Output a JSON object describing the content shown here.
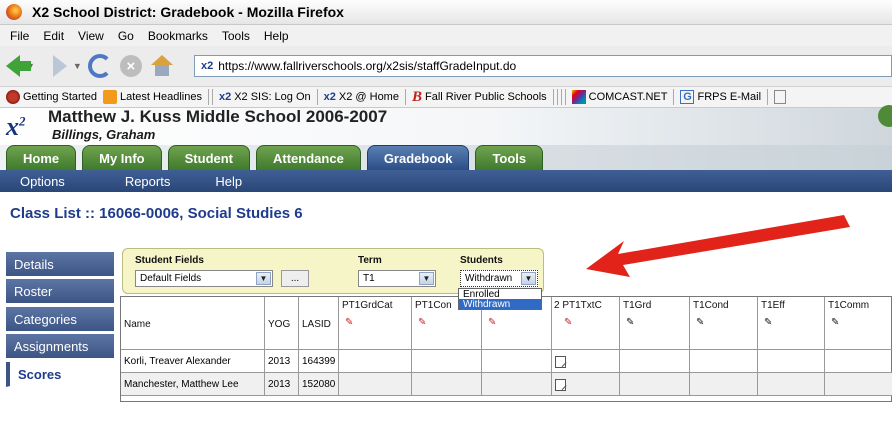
{
  "browser": {
    "title": "X2 School District: Gradebook - Mozilla Firefox",
    "menu": [
      "File",
      "Edit",
      "View",
      "Go",
      "Bookmarks",
      "Tools",
      "Help"
    ],
    "url": "https://www.fallriverschools.org/x2sis/staffGradeInput.do",
    "url_prefix": "x2"
  },
  "bookmarks": [
    "Getting Started",
    "Latest Headlines",
    "X2 SIS: Log On",
    "X2 @ Home",
    "Fall River Public Schools",
    "COMCAST.NET",
    "FRPS E-Mail"
  ],
  "app": {
    "logo": "x",
    "logo_sup": "2",
    "school": "Matthew J. Kuss Middle School 2006-2007",
    "user": "Billings, Graham",
    "tabs": [
      "Home",
      "My Info",
      "Student",
      "Attendance",
      "Gradebook",
      "Tools"
    ],
    "active_tab": "Gradebook",
    "subnav": [
      "Options",
      "Reports",
      "Help"
    ],
    "class_title": "Class List :: 16066-0006, Social Studies 6",
    "side": [
      "Details",
      "Roster",
      "Categories",
      "Assignments",
      "Scores"
    ],
    "active_side": "Scores"
  },
  "filters": {
    "student_fields_label": "Student Fields",
    "student_fields_value": "Default Fields",
    "dots": "...",
    "term_label": "Term",
    "term_value": "T1",
    "students_label": "Students",
    "students_value": "Withdrawn",
    "students_options": [
      "Enrolled",
      "Withdrawn"
    ]
  },
  "grid": {
    "columns": [
      "Name",
      "YOG",
      "LASID",
      "PT1GrdCat",
      "PT1Con",
      "2",
      "PT1TxtC",
      "T1Grd",
      "T1Cond",
      "T1Eff",
      "T1Comm"
    ],
    "rows": [
      {
        "name": "Korli, Treaver Alexander",
        "yog": "2013",
        "lasid": "164399"
      },
      {
        "name": "Manchester, Matthew Lee",
        "yog": "2013",
        "lasid": "152080"
      }
    ]
  },
  "colors": {
    "tab_green": "#4f8a38",
    "tab_blue": "#2b4e88",
    "nav_blue": "#2a4677",
    "title_blue": "#1f3c8c",
    "filter_bg": "#f5f5c8",
    "arrow_red": "#e2231a"
  }
}
